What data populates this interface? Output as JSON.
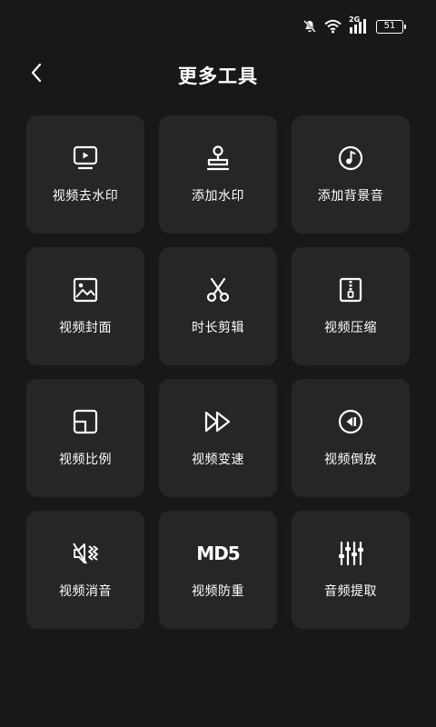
{
  "status_bar": {
    "network_label": "2G",
    "battery_level": "51",
    "icons": [
      "mute-icon",
      "wifi-icon",
      "signal-icon",
      "battery-icon"
    ]
  },
  "header": {
    "back_icon": "chevron-left-icon",
    "title": "更多工具"
  },
  "tools": [
    {
      "label": "视频去水印",
      "icon": "video-screen-icon"
    },
    {
      "label": "添加水印",
      "icon": "stamp-icon"
    },
    {
      "label": "添加背景音",
      "icon": "music-note-icon"
    },
    {
      "label": "视频封面",
      "icon": "image-icon"
    },
    {
      "label": "时长剪辑",
      "icon": "scissors-icon"
    },
    {
      "label": "视频压缩",
      "icon": "zip-file-icon"
    },
    {
      "label": "视频比例",
      "icon": "aspect-ratio-icon"
    },
    {
      "label": "视频变速",
      "icon": "fast-forward-icon"
    },
    {
      "label": "视频倒放",
      "icon": "rewind-icon"
    },
    {
      "label": "视频消音",
      "icon": "mute-speaker-icon"
    },
    {
      "label": "视频防重",
      "icon": "md5-icon",
      "icon_text": "MD5"
    },
    {
      "label": "音频提取",
      "icon": "equalizer-icon"
    }
  ],
  "colors": {
    "background": "#18181a",
    "card": "#262628",
    "text": "#ffffff"
  }
}
